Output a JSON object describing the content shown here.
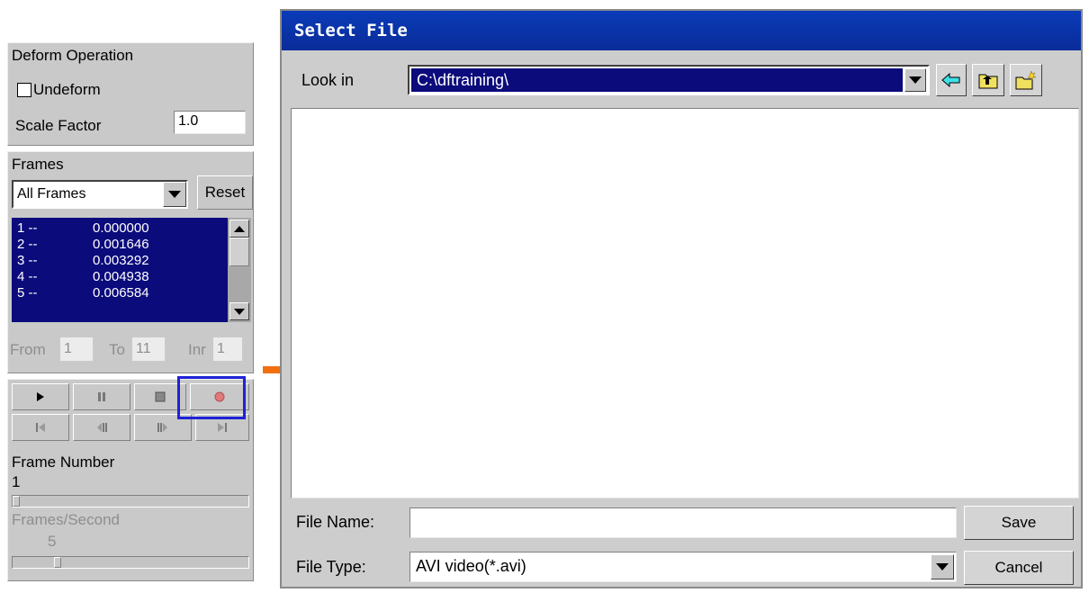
{
  "left_panel": {
    "deform": {
      "title": "Deform Operation",
      "undeform_label": "Undeform",
      "undeform_checked": false,
      "scale_label": "Scale Factor",
      "scale_value": "1.0"
    },
    "frames": {
      "title": "Frames",
      "selected": "All Frames",
      "reset_label": "Reset",
      "rows": [
        {
          "n": "1 --",
          "v": "0.000000"
        },
        {
          "n": "2 --",
          "v": "0.001646"
        },
        {
          "n": "3 --",
          "v": "0.003292"
        },
        {
          "n": "4 --",
          "v": "0.004938"
        },
        {
          "n": "5 --",
          "v": "0.006584"
        }
      ],
      "from_label": "From",
      "from_value": "1",
      "to_label": "To",
      "to_value": "11",
      "inr_label": "Inr",
      "inr_value": "1"
    },
    "playback": {
      "buttons_row1": [
        "play-icon",
        "pause-icon",
        "stop-icon",
        "record-icon"
      ],
      "buttons_row2": [
        "first-frame-icon",
        "step-back-icon",
        "step-forward-icon",
        "last-frame-icon"
      ],
      "highlight_color": "#1f22d6",
      "record_color": "#e07a7a"
    },
    "frame_number": {
      "label": "Frame Number",
      "value": "1",
      "slider_fraction": 0.0
    },
    "fps": {
      "label": "Frames/Second",
      "value": "5",
      "slider_fraction": 0.18
    }
  },
  "arrow_color": "#f07010",
  "dialog": {
    "title": "Select File",
    "look_in_label": "Look in",
    "look_in_value": "C:\\dftraining\\",
    "toolbar_icons": [
      "back-arrow-icon",
      "up-folder-icon",
      "new-folder-icon"
    ],
    "file_name_label": "File Name:",
    "file_name_value": "",
    "file_type_label": "File Type:",
    "file_type_value": "AVI video(*.avi)",
    "save_label": "Save",
    "cancel_label": "Cancel",
    "title_color": "#0a34aa",
    "selection_color": "#0b0b7c"
  }
}
